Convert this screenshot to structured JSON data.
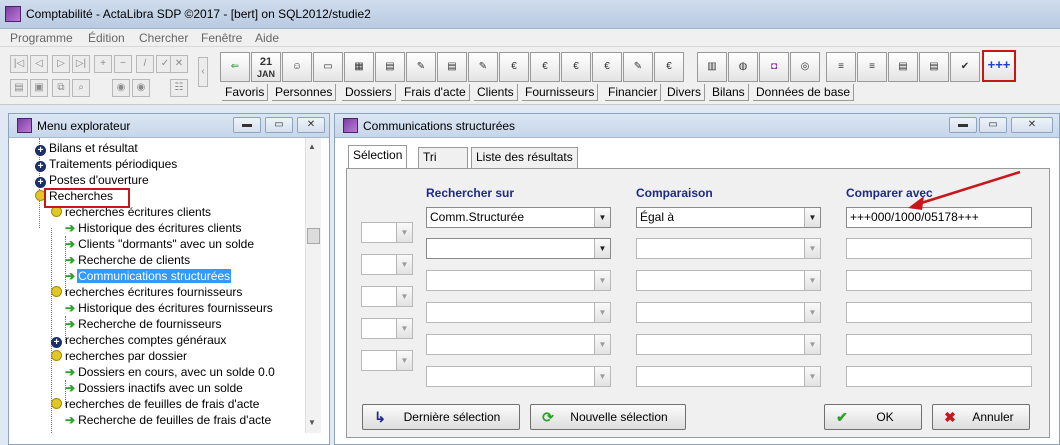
{
  "app": {
    "title": "Comptabilité - ActaLibra  SDP ©2017 - [bert]  on  SQL2012/studie2"
  },
  "menu": {
    "items": [
      "Programme",
      "Édition",
      "Chercher",
      "Fenêtre",
      "Aide"
    ]
  },
  "toolbar": {
    "calendar_day": "21",
    "calendar_month": "JAN",
    "highlighted_button": "+++",
    "category_tabs": [
      "Favoris",
      "Personnes",
      "Dossiers",
      "Frais d'acte",
      "Clients",
      "Fournisseurs",
      "Financier",
      "Divers",
      "Bilans",
      "Données de base"
    ]
  },
  "explorer": {
    "title": "Menu explorateur",
    "items": [
      {
        "label": "Bilans et résultat"
      },
      {
        "label": "Traitements périodiques"
      },
      {
        "label": "Postes d'ouverture"
      },
      {
        "label": "Recherches"
      },
      {
        "label": "recherches écritures clients"
      },
      {
        "label": "Historique des écritures clients"
      },
      {
        "label": "Clients \"dormants\" avec un solde"
      },
      {
        "label": "Recherche de clients"
      },
      {
        "label": "Communications structurées"
      },
      {
        "label": "recherches écritures fournisseurs"
      },
      {
        "label": "Historique des écritures fournisseurs"
      },
      {
        "label": "Recherche de fournisseurs"
      },
      {
        "label": "recherches comptes généraux"
      },
      {
        "label": "recherches par dossier"
      },
      {
        "label": "Dossiers en cours, avec un solde 0.0"
      },
      {
        "label": "Dossiers inactifs avec un solde"
      },
      {
        "label": "recherches de feuilles de frais d'acte"
      },
      {
        "label": "Recherche de feuilles de frais d'acte"
      }
    ]
  },
  "dialog": {
    "title": "Communications structurées",
    "tabs": [
      "Sélection",
      "Tri",
      "Liste des résultats"
    ],
    "headers": {
      "search_on": "Rechercher sur",
      "comparison": "Comparaison",
      "compare_with": "Comparer avec"
    },
    "row1": {
      "field": "Comm.Structurée",
      "comparison": "Égal à",
      "value": "+++000/1000/05178+++"
    },
    "buttons": {
      "last": "Dernière sélection",
      "new": "Nouvelle sélection",
      "ok": "OK",
      "cancel": "Annuler"
    }
  },
  "colors": {
    "highlight_red": "#c8171b",
    "selection_blue": "#3399ff",
    "header_blue": "#1c2b8a"
  }
}
